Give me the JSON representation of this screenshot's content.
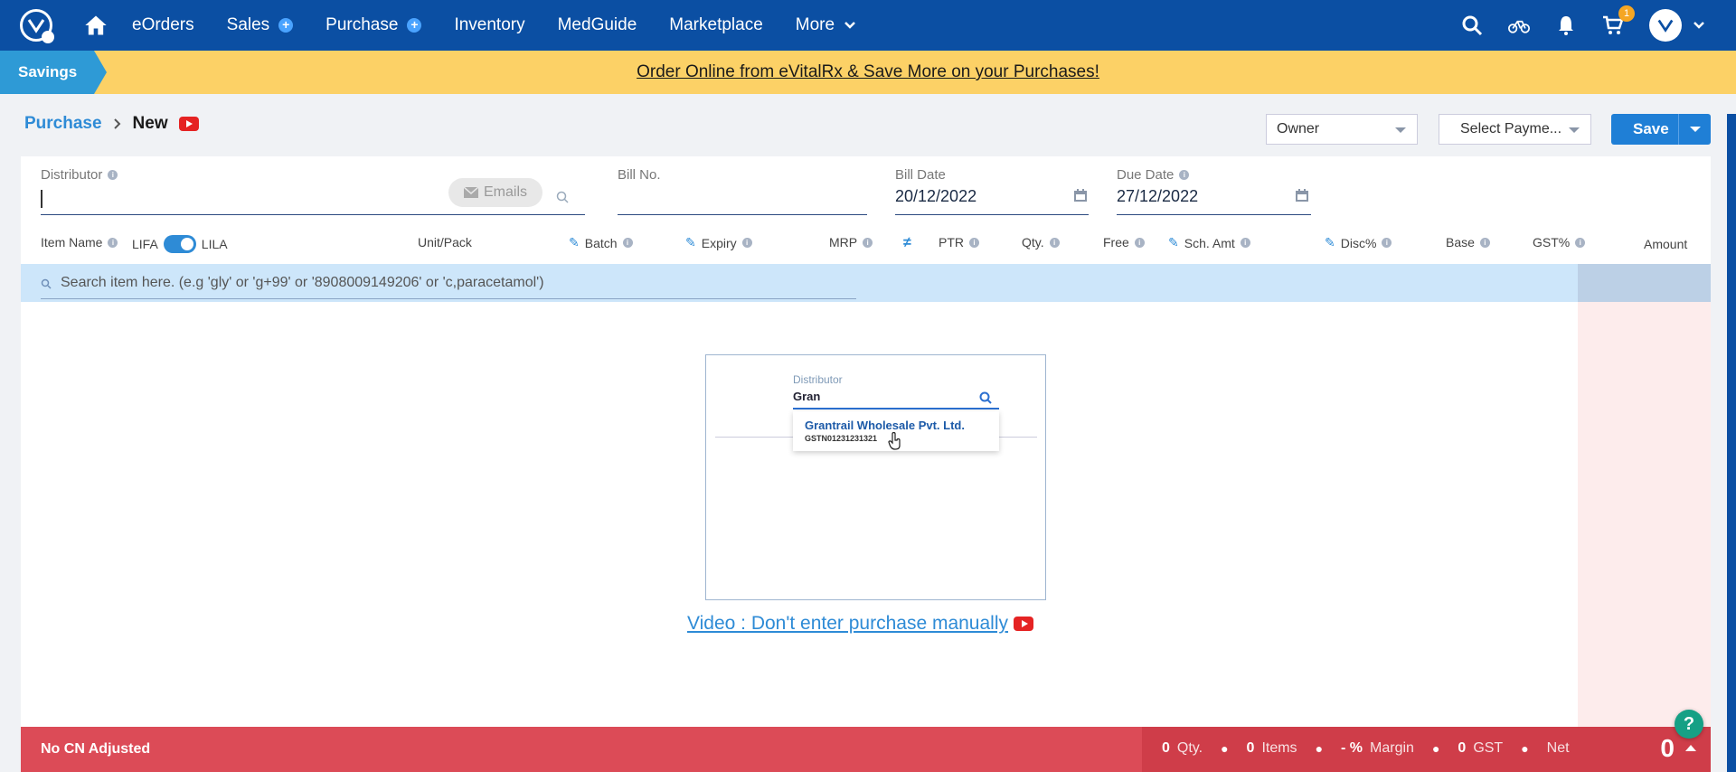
{
  "nav": {
    "items": [
      {
        "label": "eOrders",
        "plus": false
      },
      {
        "label": "Sales",
        "plus": true
      },
      {
        "label": "Purchase",
        "plus": true
      },
      {
        "label": "Inventory",
        "plus": false
      },
      {
        "label": "MedGuide",
        "plus": false
      },
      {
        "label": "Marketplace",
        "plus": false
      },
      {
        "label": "More",
        "plus": false
      }
    ],
    "cart_count": "1",
    "accent": "#0b4fa3"
  },
  "banner": {
    "tag": "Savings",
    "text": "Order Online from eVitalRx & Save More on your Purchases!"
  },
  "breadcrumb": {
    "parent": "Purchase",
    "current": "New"
  },
  "toolbar": {
    "owner_select": "Owner",
    "payment_select": "Select Payme...",
    "save_label": "Save"
  },
  "form": {
    "distributor_label": "Distributor",
    "emails_label": "Emails",
    "bill_no_label": "Bill No.",
    "bill_date_label": "Bill Date",
    "bill_date_value": "20/12/2022",
    "due_date_label": "Due Date",
    "due_date_value": "27/12/2022"
  },
  "columns": {
    "item_name": "Item Name",
    "lifa": "LIFA",
    "lila": "LILA",
    "unit_pack": "Unit/Pack",
    "batch": "Batch",
    "expiry": "Expiry",
    "mrp": "MRP",
    "ptr": "PTR",
    "qty": "Qty.",
    "free": "Free",
    "sch_amt": "Sch. Amt",
    "disc": "Disc%",
    "base": "Base",
    "gst": "GST%",
    "amount": "Amount"
  },
  "search": {
    "placeholder": "Search item here. (e.g 'gly' or 'g+99' or '8908009149206' or 'c,paracetamol')"
  },
  "video": {
    "distributor_label": "Distributor",
    "input_value": "Gran",
    "result_name": "Grantrail Wholesale Pvt. Ltd.",
    "result_gst": "GSTN01231231321",
    "link_text": "Video : Don't enter purchase manually"
  },
  "footer": {
    "left": "No CN Adjusted",
    "qty_value": "0",
    "qty_label": "Qty.",
    "items_value": "0",
    "items_label": "Items",
    "margin_value": "- %",
    "margin_label": "Margin",
    "gst_value": "0",
    "gst_label": "GST",
    "net_label": "Net",
    "total": "0"
  },
  "help_label": "?"
}
